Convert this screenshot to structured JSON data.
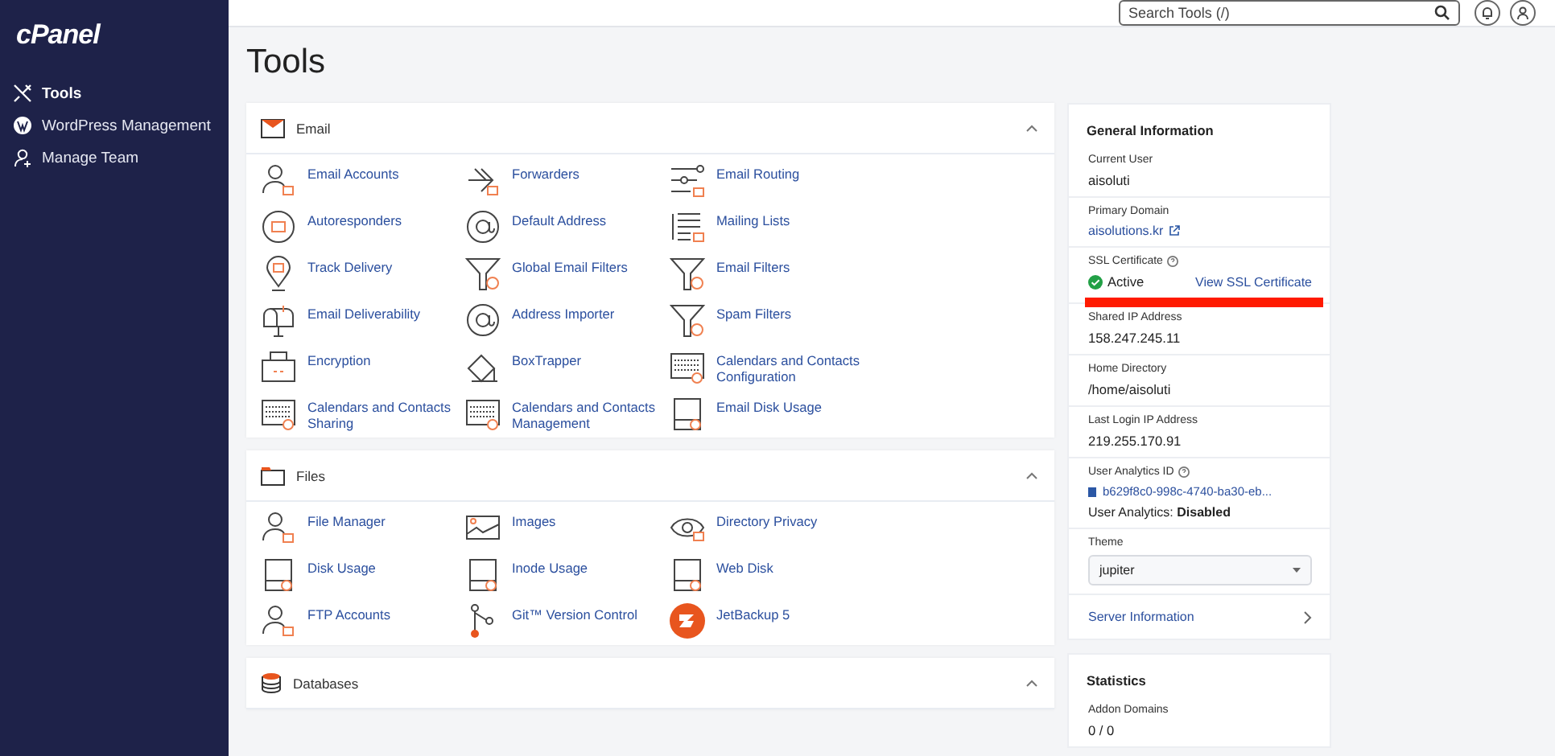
{
  "sidebar": {
    "logo": "cPanel",
    "items": [
      {
        "label": "Tools",
        "selected": true
      },
      {
        "label": "WordPress Management",
        "selected": false
      },
      {
        "label": "Manage Team",
        "selected": false
      }
    ]
  },
  "topbar": {
    "search": {
      "placeholder": "Search Tools (/)"
    }
  },
  "page_title": "Tools",
  "sections": [
    {
      "title": "Email",
      "expanded": true,
      "items": [
        "Email Accounts",
        "Forwarders",
        "Email Routing",
        "Autoresponders",
        "Default Address",
        "Mailing Lists",
        "Track Delivery",
        "Global Email Filters",
        "Email Filters",
        "Email Deliverability",
        "Address Importer",
        "Spam Filters",
        "Encryption",
        "BoxTrapper",
        "Calendars and Contacts Configuration",
        "Calendars and Contacts Sharing",
        "Calendars and Contacts Management",
        "Email Disk Usage"
      ]
    },
    {
      "title": "Files",
      "expanded": true,
      "items": [
        "File Manager",
        "Images",
        "Directory Privacy",
        "Disk Usage",
        "Inode Usage",
        "Web Disk",
        "FTP Accounts",
        "Git™ Version Control",
        "JetBackup 5"
      ]
    },
    {
      "title": "Databases",
      "expanded": true
    }
  ],
  "general_information": {
    "title": "General Information",
    "current_user": {
      "label": "Current User",
      "value": "aisoluti"
    },
    "primary_domain": {
      "label": "Primary Domain",
      "value": "aisolutions.kr"
    },
    "ssl_certificate": {
      "label": "SSL Certificate",
      "status": "Active",
      "link": "View SSL Certificate"
    },
    "shared_ip": {
      "label": "Shared IP Address",
      "value": "158.247.245.11"
    },
    "home_directory": {
      "label": "Home Directory",
      "value": "/home/aisoluti"
    },
    "last_login_ip": {
      "label": "Last Login IP Address",
      "value": "219.255.170.91"
    },
    "user_analytics_id": {
      "label": "User Analytics ID",
      "value": "b629f8c0-998c-4740-ba30-eb...",
      "status": "User Analytics: **Disabled**"
    },
    "theme": {
      "label": "Theme",
      "value": "jupiter"
    },
    "server_information": "Server Information"
  },
  "statistics": {
    "title": "Statistics",
    "addon_domains": {
      "label": "Addon Domains",
      "value": "0 / 0"
    }
  }
}
